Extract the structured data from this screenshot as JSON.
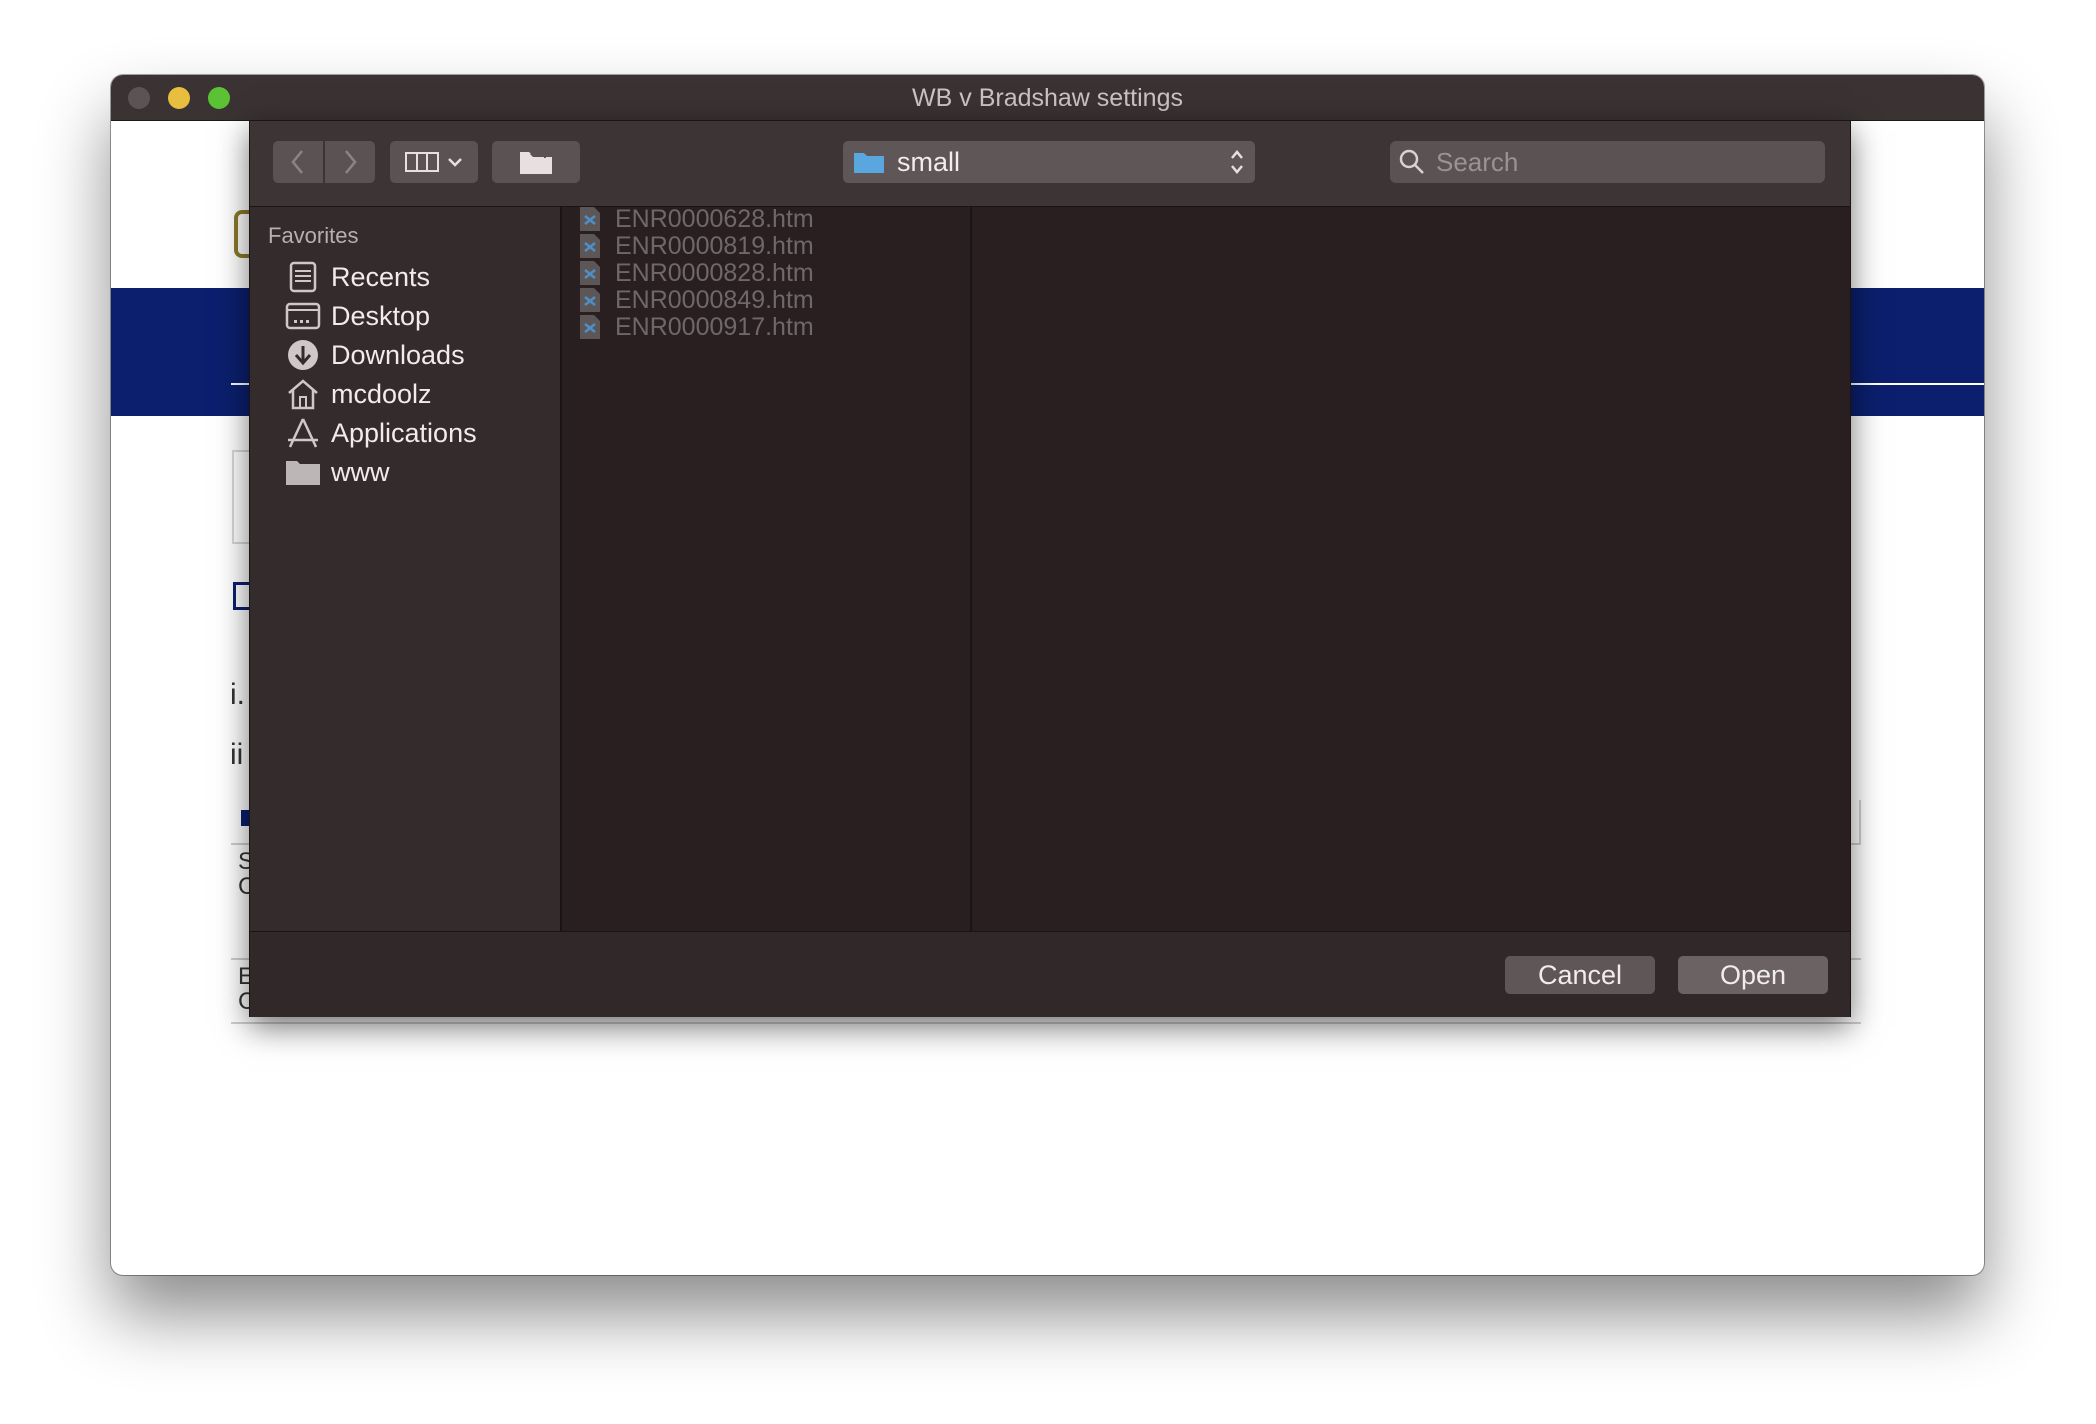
{
  "window": {
    "title": "WB v Bradshaw settings"
  },
  "background_page": {
    "fragments": [
      "i.",
      "ii",
      "S",
      "C",
      "E",
      "C"
    ],
    "colors": {
      "banner": "#0b1f6e",
      "logo": "#8a7a2a"
    }
  },
  "toolbar": {
    "back_icon": "chevron-left-icon",
    "forward_icon": "chevron-right-icon",
    "view_icon": "columns-view-icon",
    "new_folder_icon": "new-folder-icon",
    "location": "small",
    "search_placeholder": "Search"
  },
  "sidebar": {
    "heading": "Favorites",
    "items": [
      {
        "label": "Recents",
        "icon": "recents-icon"
      },
      {
        "label": "Desktop",
        "icon": "desktop-icon"
      },
      {
        "label": "Downloads",
        "icon": "downloads-icon"
      },
      {
        "label": "mcdoolz",
        "icon": "home-icon"
      },
      {
        "label": "Applications",
        "icon": "applications-icon"
      },
      {
        "label": "www",
        "icon": "folder-icon"
      }
    ]
  },
  "files": [
    {
      "name": "ENR0000628.htm",
      "enabled": false
    },
    {
      "name": "ENR0000819.htm",
      "enabled": false
    },
    {
      "name": "ENR0000828.htm",
      "enabled": false
    },
    {
      "name": "ENR0000849.htm",
      "enabled": false
    },
    {
      "name": "ENR0000917.htm",
      "enabled": false
    }
  ],
  "footer": {
    "cancel_label": "Cancel",
    "open_label": "Open"
  }
}
